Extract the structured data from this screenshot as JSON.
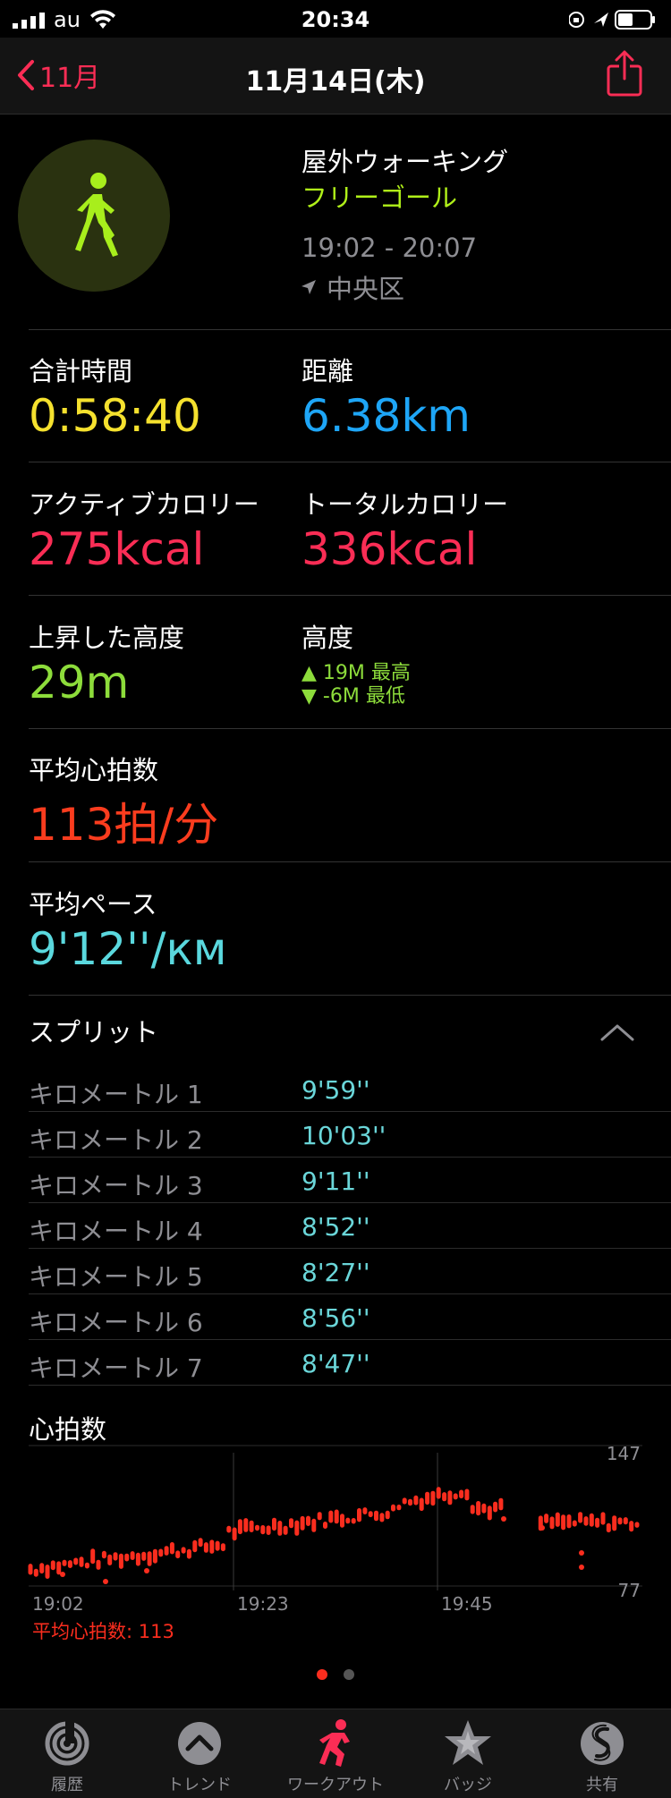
{
  "status": {
    "carrier": "au",
    "time": "20:34"
  },
  "nav": {
    "back_label": "11月",
    "title": "11月14日(木)"
  },
  "workout": {
    "title": "屋外ウォーキング",
    "goal": "フリーゴール",
    "time_range": "19:02 - 20:07",
    "location": "中央区"
  },
  "metrics": {
    "total_time": {
      "label": "合計時間",
      "value": "0:58:40",
      "color": "#f5e12e"
    },
    "distance": {
      "label": "距離",
      "value": "6.38km",
      "color": "#1ea6f7"
    },
    "active_cal": {
      "label": "アクティブカロリー",
      "value": "275kcal",
      "color": "#fa2d55"
    },
    "total_cal": {
      "label": "トータルカロリー",
      "value": "336kcal",
      "color": "#fa2d55"
    },
    "elev_gain": {
      "label": "上昇した高度",
      "value": "29m",
      "color": "#8ddc3b"
    },
    "elevation": {
      "label": "高度",
      "high": "▲ 19M 最高",
      "low": "▼ -6M 最低"
    },
    "avg_hr": {
      "label": "平均心拍数",
      "value": "113拍/分",
      "color": "#fa3c1e"
    },
    "avg_pace": {
      "label": "平均ペース",
      "value": "9'12''/км",
      "color": "#5ad8de"
    }
  },
  "splits": {
    "title": "スプリット",
    "rows": [
      {
        "label": "キロメートル 1",
        "pace": "9'59''"
      },
      {
        "label": "キロメートル 2",
        "pace": "10'03''"
      },
      {
        "label": "キロメートル 3",
        "pace": "9'11''"
      },
      {
        "label": "キロメートル 4",
        "pace": "8'52''"
      },
      {
        "label": "キロメートル 5",
        "pace": "8'27''"
      },
      {
        "label": "キロメートル 6",
        "pace": "8'56''"
      },
      {
        "label": "キロメートル 7",
        "pace": "8'47''"
      }
    ]
  },
  "heart_rate": {
    "title": "心拍数",
    "y_max": "147",
    "y_min": "77",
    "x_labels": [
      "19:02",
      "19:23",
      "19:45"
    ],
    "avg_label": "平均心拍数: 113",
    "color": "#fa2d1e"
  },
  "tabs": [
    {
      "label": "履歴",
      "icon": "history-rings-icon",
      "active": false
    },
    {
      "label": "トレンド",
      "icon": "trends-chevron-icon",
      "active": false
    },
    {
      "label": "ワークアウト",
      "icon": "workout-runner-icon",
      "active": true
    },
    {
      "label": "バッジ",
      "icon": "badge-star-icon",
      "active": false
    },
    {
      "label": "共有",
      "icon": "sharing-icon",
      "active": false
    }
  ]
}
